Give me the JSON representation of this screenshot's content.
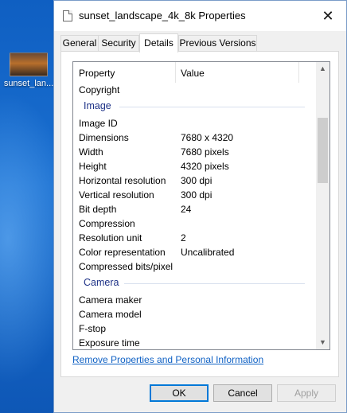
{
  "desktop": {
    "icon_label": "sunset_lan..."
  },
  "window": {
    "title": "sunset_landscape_4k_8k Properties",
    "close_glyph": "✕"
  },
  "tabs": [
    {
      "label": "General"
    },
    {
      "label": "Security"
    },
    {
      "label": "Details",
      "active": true
    },
    {
      "label": "Previous Versions"
    }
  ],
  "details": {
    "col_property": "Property",
    "col_value": "Value",
    "rows_top": [
      {
        "property": "Copyright",
        "value": ""
      }
    ],
    "group_image": "Image",
    "rows_image": [
      {
        "property": "Image ID",
        "value": ""
      },
      {
        "property": "Dimensions",
        "value": "7680 x 4320"
      },
      {
        "property": "Width",
        "value": "7680 pixels"
      },
      {
        "property": "Height",
        "value": "4320 pixels"
      },
      {
        "property": "Horizontal resolution",
        "value": "300 dpi"
      },
      {
        "property": "Vertical resolution",
        "value": "300 dpi"
      },
      {
        "property": "Bit depth",
        "value": "24"
      },
      {
        "property": "Compression",
        "value": ""
      },
      {
        "property": "Resolution unit",
        "value": "2"
      },
      {
        "property": "Color representation",
        "value": "Uncalibrated"
      },
      {
        "property": "Compressed bits/pixel",
        "value": ""
      }
    ],
    "group_camera": "Camera",
    "rows_camera": [
      {
        "property": "Camera maker",
        "value": ""
      },
      {
        "property": "Camera model",
        "value": ""
      },
      {
        "property": "F-stop",
        "value": ""
      },
      {
        "property": "Exposure time",
        "value": ""
      }
    ]
  },
  "link_remove": "Remove Properties and Personal Information",
  "buttons": {
    "ok": "OK",
    "cancel": "Cancel",
    "apply": "Apply"
  },
  "colors": {
    "accent": "#0078d7",
    "link": "#0f61c4",
    "group_header": "#1e3287"
  }
}
